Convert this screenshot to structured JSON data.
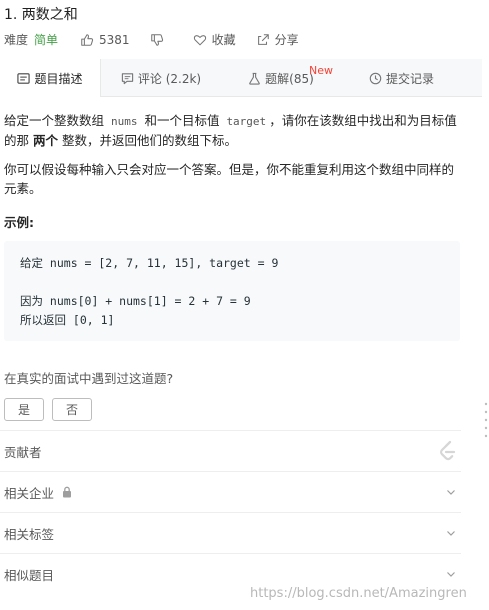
{
  "problem": {
    "title": "1. 两数之和",
    "difficulty_label": "难度",
    "difficulty": "简单",
    "likes": "5381",
    "collect_label": "收藏",
    "share_label": "分享"
  },
  "tabs": {
    "description": "题目描述",
    "comments": "评论 (2.2k)",
    "solutions": "题解(85)",
    "new_badge": "New",
    "submissions": "提交记录"
  },
  "description": {
    "p1_a": "给定一个整数数组 ",
    "p1_code1": "nums",
    "p1_b": " 和一个目标值 ",
    "p1_code2": "target",
    "p1_c": "，请你在该数组中找出和为目标值的那 ",
    "p1_bold": "两个",
    "p1_d": " 整数，并返回他们的数组下标。",
    "p2": "你可以假设每种输入只会对应一个答案。但是，你不能重复利用这个数组中同样的元素。",
    "example_title": "示例:",
    "example_line1": "给定 nums = [2, 7, 11, 15], target = 9",
    "example_line2": "因为 nums[0] + nums[1] = 2 + 7 = 9",
    "example_line3": "所以返回 [0, 1]"
  },
  "interview": {
    "question": "在真实的面试中遇到过这道题?",
    "yes": "是",
    "no": "否"
  },
  "sections": {
    "contributors": "贡献者",
    "companies": "相关企业",
    "tags": "相关标签",
    "similar": "相似题目"
  },
  "watermark": "https://blog.csdn.net/Amazingren",
  "colors": {
    "easy": "#43a047",
    "new_badge": "#f44336"
  }
}
